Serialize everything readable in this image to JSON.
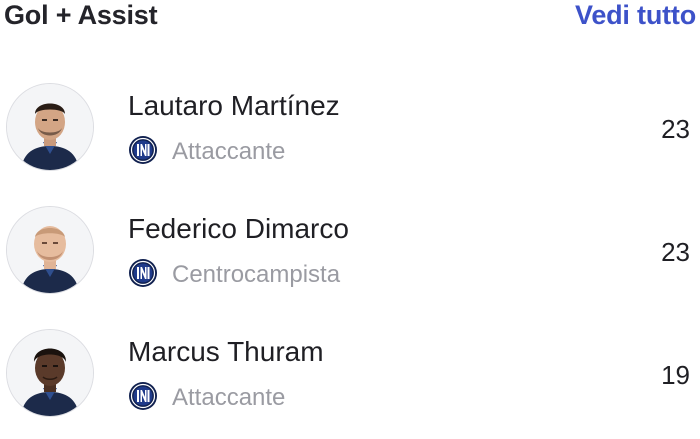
{
  "header": {
    "title": "Gol + Assist",
    "see_all": "Vedi tutto"
  },
  "colors": {
    "accent": "#3d52c9",
    "text": "#1f1f24",
    "muted": "#9a9ba2",
    "club_badge": "#10204f"
  },
  "players": [
    {
      "name": "Lautaro Martínez",
      "role": "Attaccante",
      "value": "23",
      "club_icon": "inter-badge-icon"
    },
    {
      "name": "Federico Dimarco",
      "role": "Centrocampista",
      "value": "23",
      "club_icon": "inter-badge-icon"
    },
    {
      "name": "Marcus Thuram",
      "role": "Attaccante",
      "value": "19",
      "club_icon": "inter-badge-icon"
    }
  ]
}
